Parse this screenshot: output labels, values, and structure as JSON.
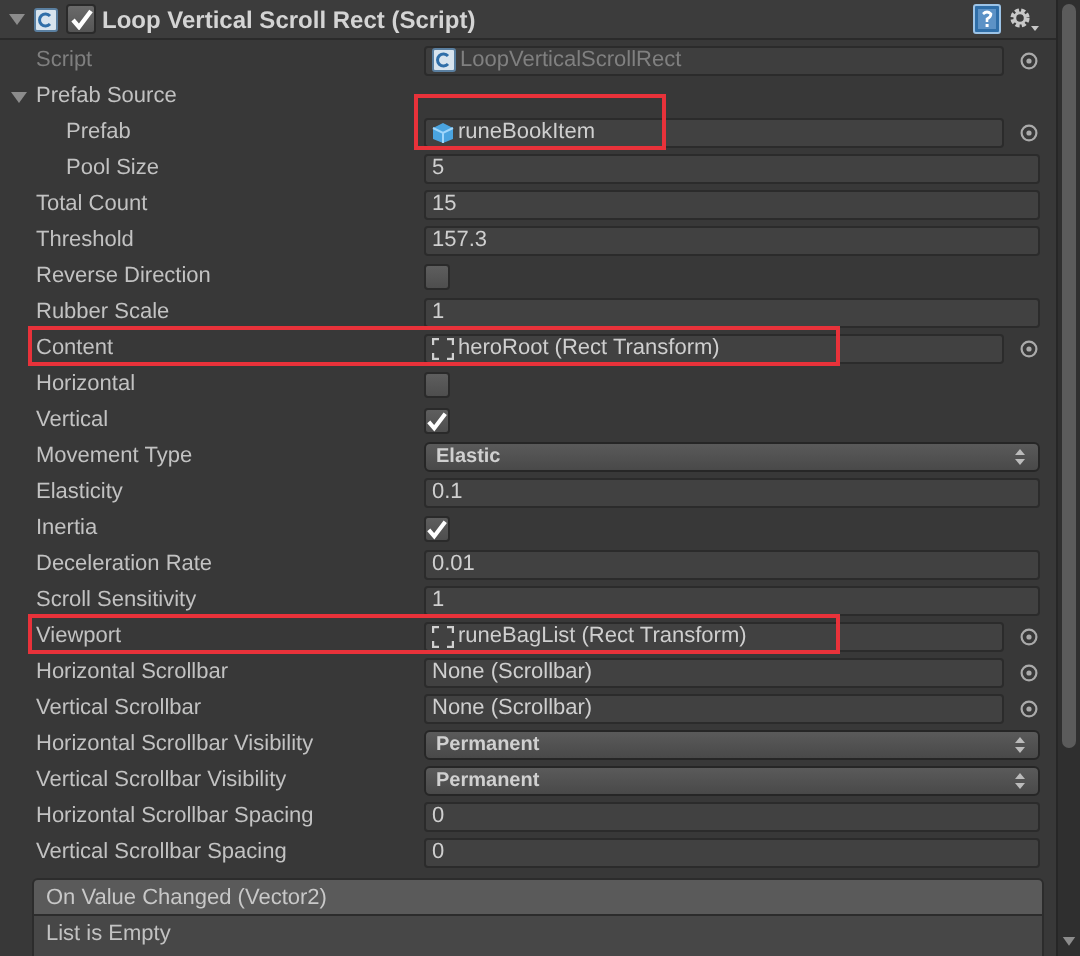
{
  "component": {
    "title": "Loop Vertical Scroll Rect (Script)",
    "enabled": true,
    "expanded": true
  },
  "properties": [
    {
      "kind": "script_ref",
      "label": "Script",
      "value": "LoopVerticalScrollRect",
      "disabled": true
    },
    {
      "kind": "foldout",
      "label": "Prefab Source",
      "expanded": true,
      "children": [
        {
          "kind": "prefab_ref",
          "label": "Prefab",
          "value": "runeBookItem",
          "value_highlighted": true
        },
        {
          "kind": "number",
          "label": "Pool Size",
          "value": "5"
        }
      ]
    },
    {
      "kind": "number",
      "label": "Total Count",
      "value": "15"
    },
    {
      "kind": "number",
      "label": "Threshold",
      "value": "157.3"
    },
    {
      "kind": "checkbox",
      "label": "Reverse Direction",
      "checked": false
    },
    {
      "kind": "number",
      "label": "Rubber Scale",
      "value": "1"
    },
    {
      "kind": "rect_ref",
      "label": "Content",
      "value": "heroRoot (Rect Transform)",
      "row_highlighted": true
    },
    {
      "kind": "checkbox",
      "label": "Horizontal",
      "checked": false
    },
    {
      "kind": "checkbox",
      "label": "Vertical",
      "checked": true
    },
    {
      "kind": "dropdown",
      "label": "Movement Type",
      "value": "Elastic"
    },
    {
      "kind": "number",
      "label": "Elasticity",
      "value": "0.1"
    },
    {
      "kind": "checkbox",
      "label": "Inertia",
      "checked": true
    },
    {
      "kind": "number",
      "label": "Deceleration Rate",
      "value": "0.01"
    },
    {
      "kind": "number",
      "label": "Scroll Sensitivity",
      "value": "1"
    },
    {
      "kind": "rect_ref",
      "label": "Viewport",
      "value": "runeBagList (Rect Transform)",
      "row_highlighted": true
    },
    {
      "kind": "object",
      "label": "Horizontal Scrollbar",
      "value": "None (Scrollbar)"
    },
    {
      "kind": "object",
      "label": "Vertical Scrollbar",
      "value": "None (Scrollbar)"
    },
    {
      "kind": "dropdown",
      "label": "Horizontal Scrollbar Visibility",
      "value": "Permanent"
    },
    {
      "kind": "dropdown",
      "label": "Vertical Scrollbar Visibility",
      "value": "Permanent"
    },
    {
      "kind": "number",
      "label": "Horizontal Scrollbar Spacing",
      "value": "0"
    },
    {
      "kind": "number",
      "label": "Vertical Scrollbar Spacing",
      "value": "0"
    }
  ],
  "event": {
    "title": "On Value Changed (Vector2)",
    "body": "List is Empty"
  }
}
